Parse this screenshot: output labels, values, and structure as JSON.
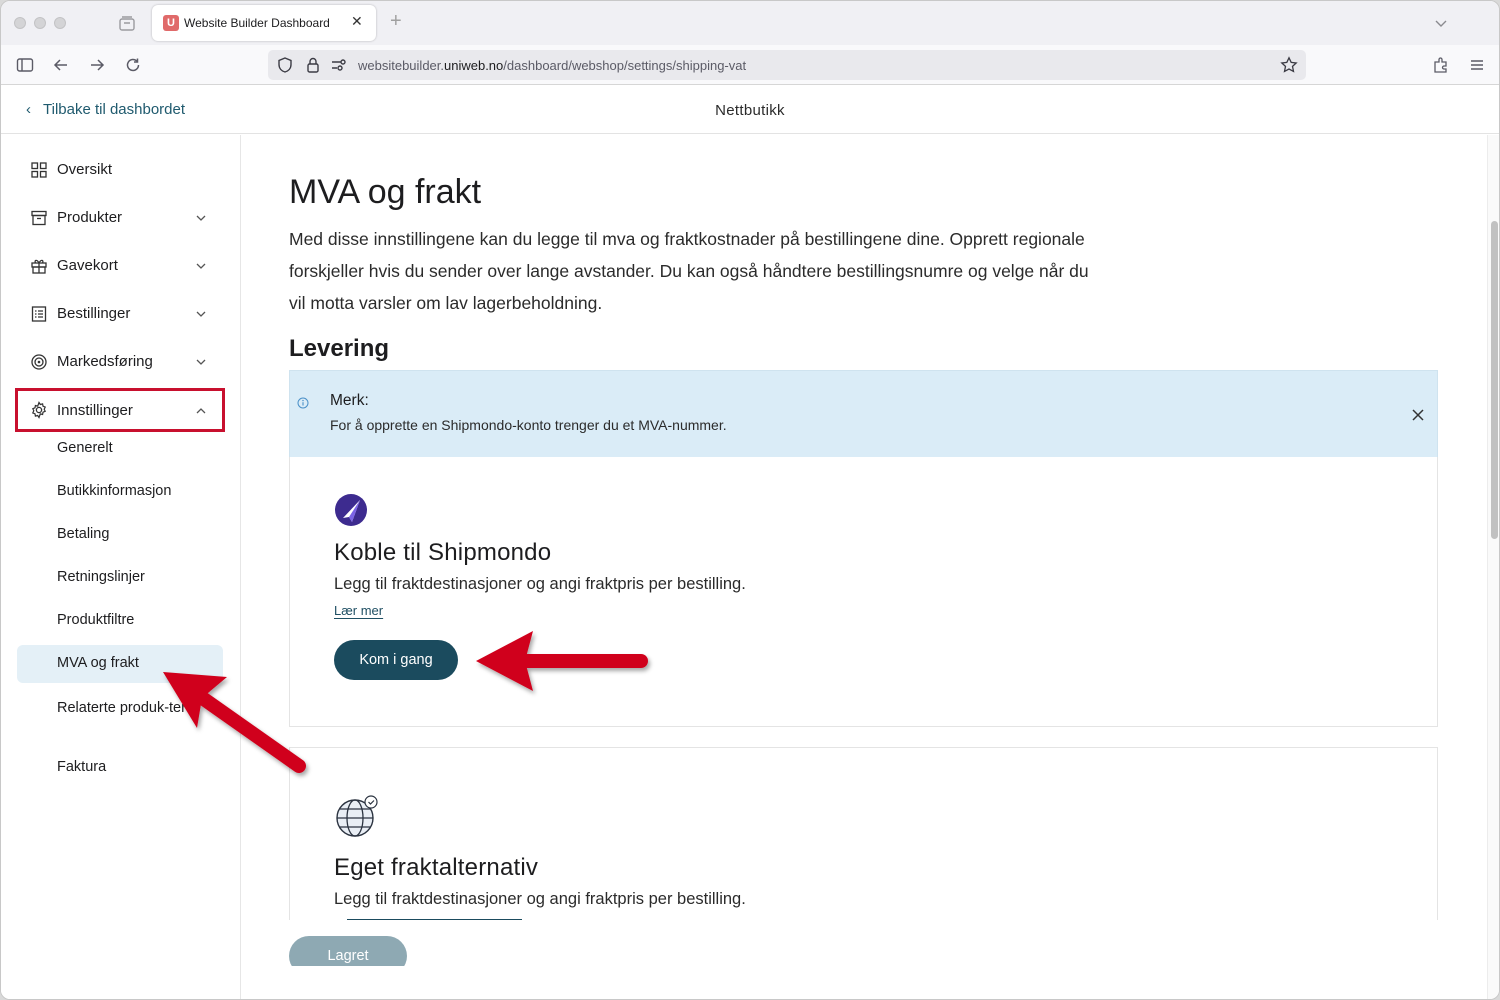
{
  "browser": {
    "tab_title": "Website Builder Dashboard",
    "tab_favicon_letter": "U",
    "url_prefix": "websitebuilder.",
    "url_domain": "uniweb.no",
    "url_path": "/dashboard/webshop/settings/shipping-vat"
  },
  "header": {
    "back_label": "Tilbake til dashbordet",
    "title": "Nettbutikk"
  },
  "sidebar": {
    "items": [
      {
        "label": "Oversikt",
        "icon": "grid-icon"
      },
      {
        "label": "Produkter",
        "icon": "box-icon"
      },
      {
        "label": "Gavekort",
        "icon": "gift-icon"
      },
      {
        "label": "Bestillinger",
        "icon": "list-icon"
      },
      {
        "label": "Markedsføring",
        "icon": "target-icon"
      },
      {
        "label": "Innstillinger",
        "icon": "gear-icon"
      }
    ],
    "sub_items": [
      "Generelt",
      "Butikkinformasjon",
      "Betaling",
      "Retningslinjer",
      "Produktfiltre",
      "MVA og frakt",
      "Relaterte produk-ter",
      "Faktura"
    ]
  },
  "main": {
    "title": "MVA og frakt",
    "intro": "Med disse innstillingene kan du legge til mva og fraktkostnader på bestillingene dine. Opprett regionale forskjeller hvis du sender over lange avstander. Du kan også håndtere bestillingsnumre og velge når du vil motta varsler om lav lagerbeholdning.",
    "section_title": "Levering",
    "notice": {
      "title": "Merk:",
      "text": "For å opprette en Shipmondo-konto trenger du et MVA-nummer."
    },
    "card1": {
      "title": "Koble til Shipmondo",
      "description": "Legg til fraktdestinasjoner og angi fraktpris per bestilling.",
      "link": "Lær mer",
      "button": "Kom i gang"
    },
    "card2": {
      "title": "Eget fraktalternativ",
      "description": "Legg til fraktdestinasjoner og angi fraktpris per bestilling."
    },
    "save_button": "Lagret"
  },
  "colors": {
    "accent": "#1b4b5e",
    "highlight": "#c8102e",
    "notice_bg": "#daecf7"
  }
}
